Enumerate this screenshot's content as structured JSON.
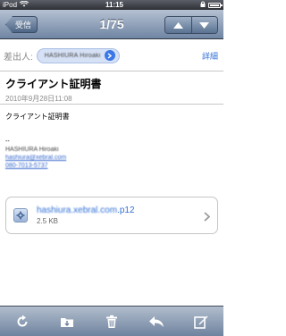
{
  "status_bar": {
    "carrier": "iPod",
    "time": "11:15"
  },
  "nav": {
    "back_label": "受信",
    "title": "1/75"
  },
  "sender": {
    "label": "差出人:",
    "name": "HASHIURA Hiroaki",
    "details_label": "詳細"
  },
  "message": {
    "subject": "クライアント証明書",
    "date": "2010年9月28日11:08",
    "body_line": "クライアント証明書",
    "signature": {
      "separator": "--",
      "name": "HASHIURA Hiroaki",
      "email": "hashiura@xebral.com",
      "phone": "080-7013-5737"
    }
  },
  "attachment": {
    "filename_base": "hashiura.xebral.com",
    "filename_ext": ".p12",
    "size": "2.5 KB"
  },
  "colors": {
    "accent": "#2f6fd6",
    "nav_bar": "#6f85a3"
  }
}
